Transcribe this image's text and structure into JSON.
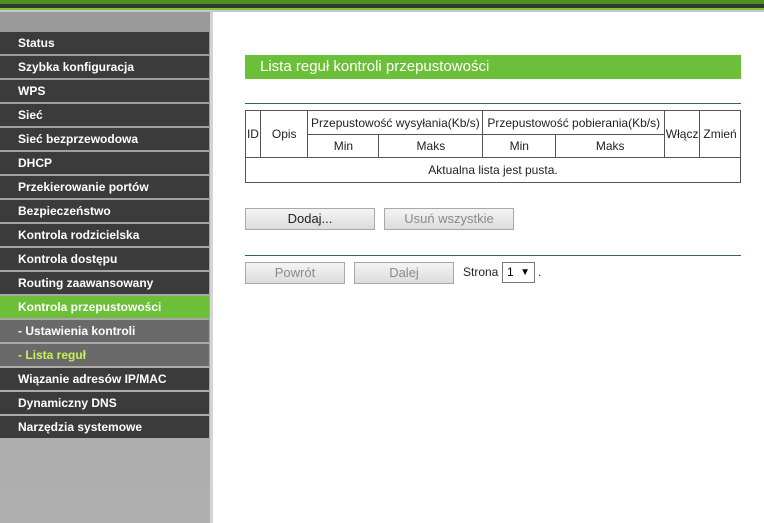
{
  "sidebar": {
    "items": [
      {
        "label": "Status",
        "type": "main"
      },
      {
        "label": "Szybka konfiguracja",
        "type": "main"
      },
      {
        "label": "WPS",
        "type": "main"
      },
      {
        "label": "Sieć",
        "type": "main"
      },
      {
        "label": "Sieć bezprzewodowa",
        "type": "main"
      },
      {
        "label": "DHCP",
        "type": "main"
      },
      {
        "label": "Przekierowanie portów",
        "type": "main"
      },
      {
        "label": "Bezpieczeństwo",
        "type": "main"
      },
      {
        "label": "Kontrola rodzicielska",
        "type": "main"
      },
      {
        "label": "Kontrola dostępu",
        "type": "main"
      },
      {
        "label": "Routing zaawansowany",
        "type": "main"
      },
      {
        "label": "Kontrola przepustowości",
        "type": "active"
      },
      {
        "label": "- Ustawienia kontroli",
        "type": "sub"
      },
      {
        "label": "- Lista reguł",
        "type": "sub-current"
      },
      {
        "label": "Wiązanie adresów IP/MAC",
        "type": "main"
      },
      {
        "label": "Dynamiczny DNS",
        "type": "main"
      },
      {
        "label": "Narzędzia systemowe",
        "type": "main"
      }
    ],
    "accent_color": "#6cbf38",
    "current_sub_color": "#c6f25a"
  },
  "main": {
    "title": "Lista reguł kontroli przepustowości",
    "table": {
      "col_id": "ID",
      "col_desc": "Opis",
      "col_upload": "Przepustowość wysyłania(Kb/s)",
      "col_download": "Przepustowość pobierania(Kb/s)",
      "col_enable": "Włącz",
      "col_edit": "Zmień",
      "sub_min": "Min",
      "sub_max": "Maks",
      "empty_message": "Aktualna lista jest pusta."
    },
    "buttons": {
      "add": "Dodaj...",
      "delete_all": "Usuń wszystkie",
      "prev": "Powrót",
      "next": "Dalej"
    },
    "pagination": {
      "page_label": "Strona",
      "current_page": "1",
      "arrow": "▼",
      "trailing": "."
    }
  }
}
